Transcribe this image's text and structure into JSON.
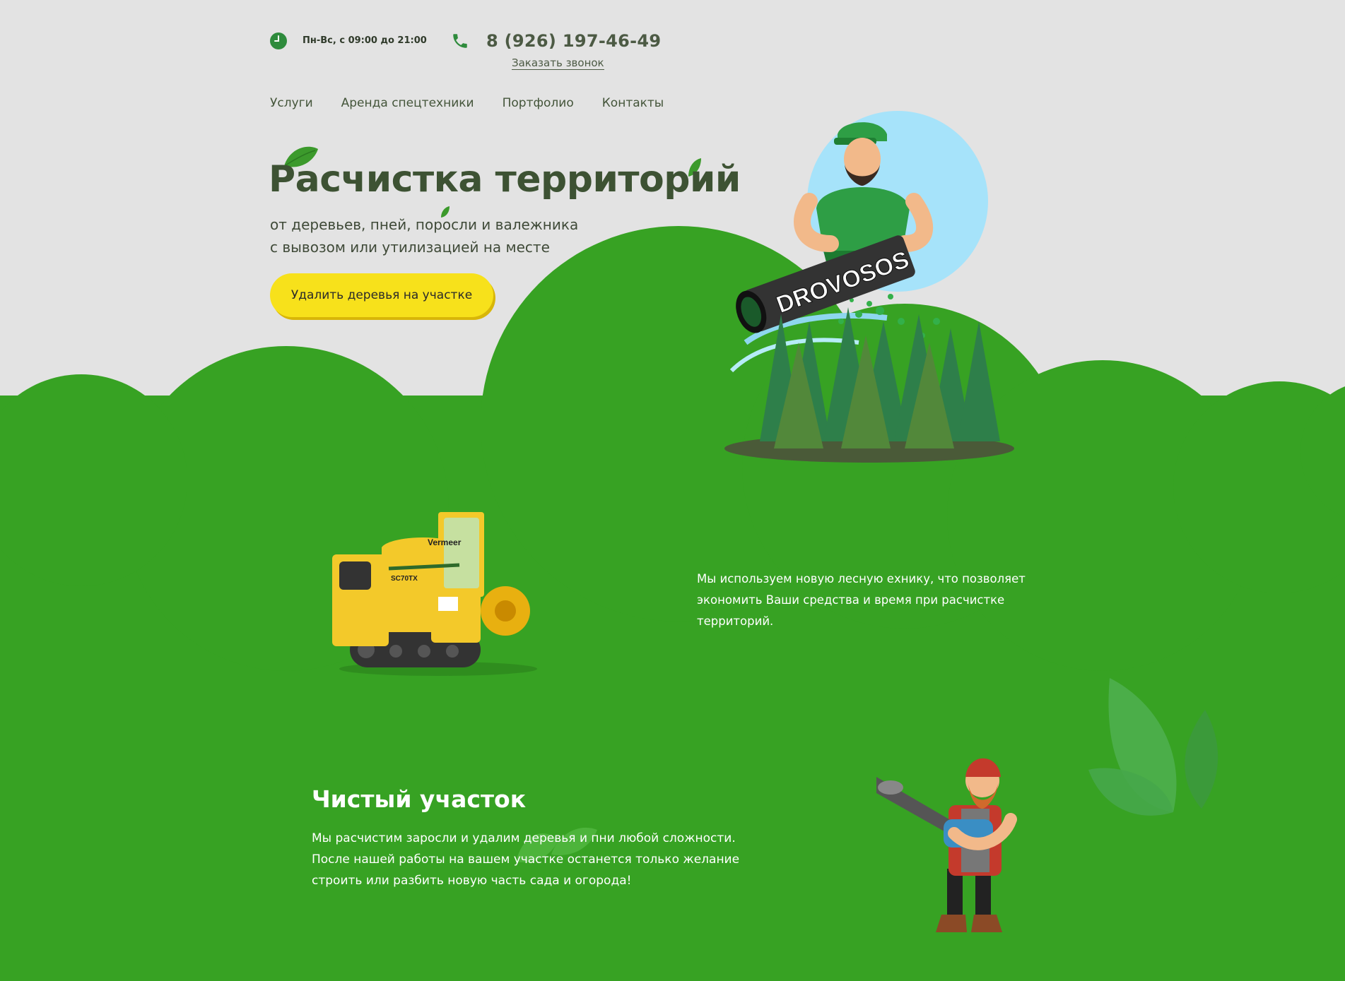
{
  "header": {
    "hours": "Пн-Вс, с 09:00 до 21:00",
    "phone": "8 (926) 197-46-49",
    "callback_label": "Заказать звонок"
  },
  "nav": {
    "items": [
      {
        "label": "Услуги"
      },
      {
        "label": "Аренда спецтехники"
      },
      {
        "label": "Портфолио"
      },
      {
        "label": "Контакты"
      }
    ]
  },
  "hero": {
    "title": "Расчистка территорий",
    "subtitle_line1": "от деревьев, пней, поросли и валежника",
    "subtitle_line2": "с вывозом или утилизацией на месте",
    "cta_label": "Удалить деревья на участке",
    "mascot_brand": "DROVOSOS"
  },
  "equipment": {
    "brand": "Vermeer",
    "model": "SC70TX",
    "text": "Мы используем новую лесную ехнику, что позволяет экономить Ваши средства и время при расчистке территорий."
  },
  "clean_section": {
    "title": "Чистый участок",
    "text": "Мы расчистим заросли и удалим деревья и пни любой сложности. После нашей работы на вашем участке останется только желание строить или разбить новую часть сада и огорода!"
  },
  "colors": {
    "background": "#e3e3e3",
    "green": "#37a223",
    "dark_green_text": "#3d5233",
    "cta_yellow": "#f7e11b"
  }
}
